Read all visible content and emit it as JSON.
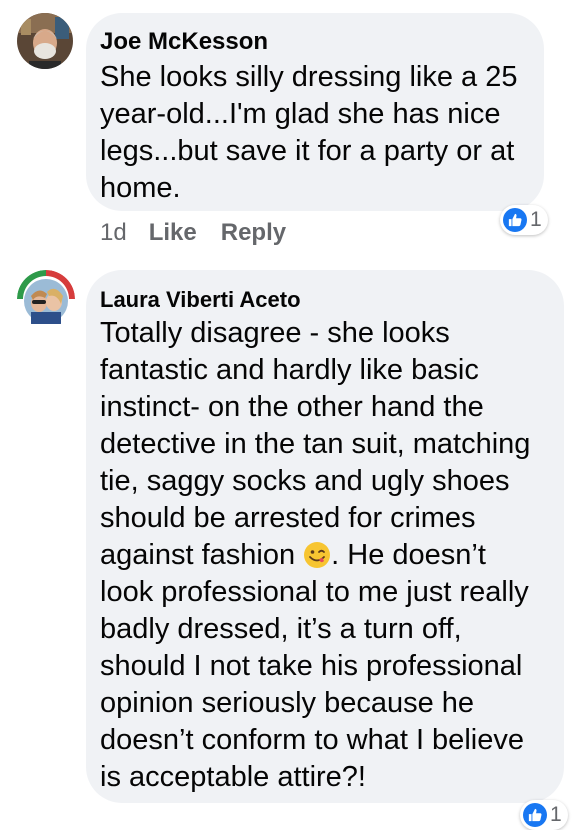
{
  "comments": [
    {
      "author": "Joe McKesson",
      "lines": [
        "She looks silly dressing like a 25",
        "year-old...I'm glad she has nice",
        "legs...but save it for a party or at",
        "home."
      ],
      "time": "1d",
      "like_label": "Like",
      "reply_label": "Reply",
      "reaction_count": "1"
    },
    {
      "author": "Laura Viberti Aceto",
      "lines": [
        "Totally disagree - she looks",
        "fantastic and hardly like basic",
        "instinct- on the other hand the",
        "detective in the tan suit, matching",
        "tie, saggy socks and ugly shoes",
        "should be arrested for crimes"
      ],
      "emoji_line_before": "against fashion ",
      "emoji_name": "face-savoring-food-emoji",
      "emoji_line_after": ". He doesn’t",
      "lines_after": [
        "look professional to me just really",
        "badly dressed, it’s a turn off,",
        "should I not take his professional",
        "opinion seriously because he",
        "doesn’t conform to what I believe",
        "is acceptable attire?!"
      ],
      "reaction_count": "1"
    }
  ],
  "colors": {
    "bubble": "#f0f2f5",
    "like_blue": "#1877f2",
    "meta_gray": "#65676b"
  }
}
